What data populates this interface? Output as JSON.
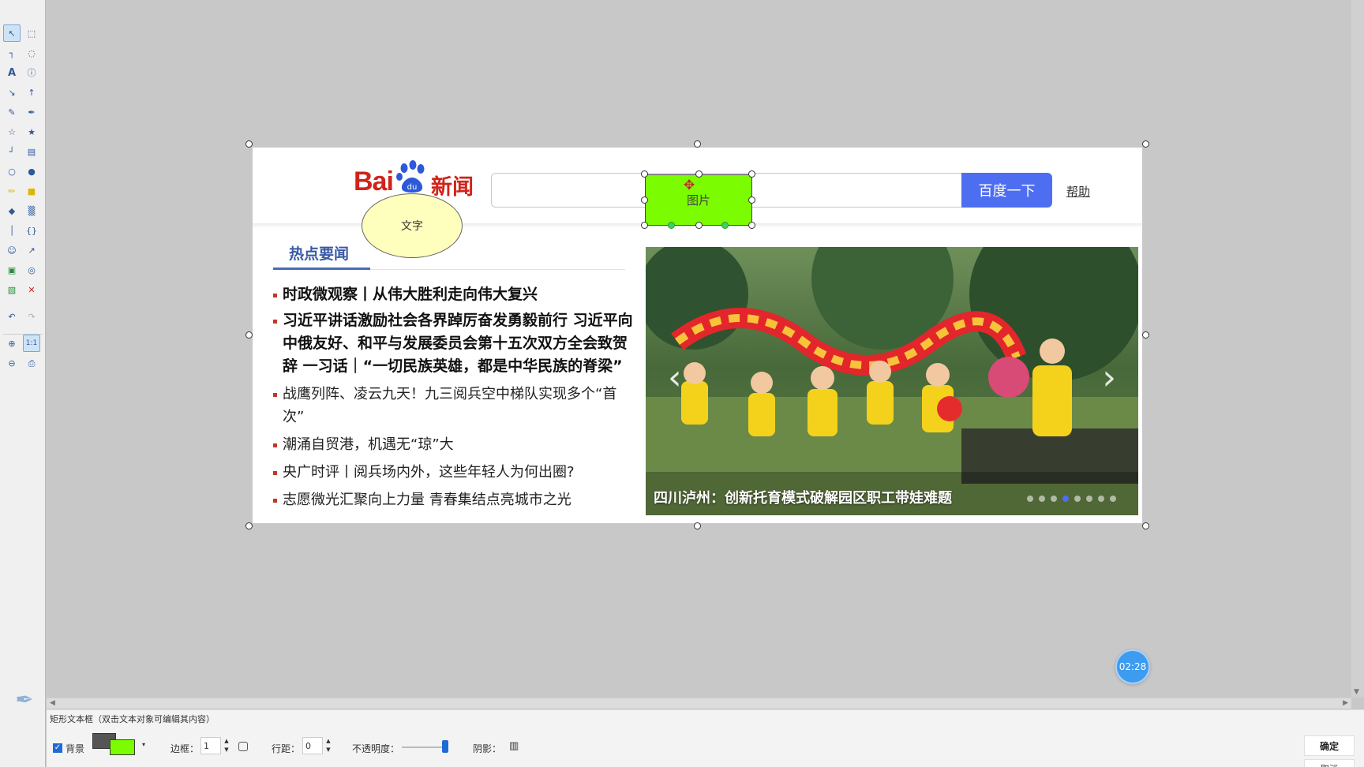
{
  "page": {
    "logo_left": "Bai",
    "logo_right": "新闻",
    "search_button": "百度一下",
    "help_link": "帮助",
    "tab_label": "热点要闻",
    "news": [
      "时政微观察丨从伟大胜利走向伟大复兴",
      "习近平讲话激励社会各界踔厉奋发勇毅前行  习近平向中俄友好、和平与发展委员会第十五次双方全会致贺辞  一习话｜“一切民族英雄，都是中华民族的脊梁”",
      "战鹰列阵、凌云九天！九三阅兵空中梯队实现多个“首次”",
      "潮涌自贸港，机遇无“琼”大",
      "央广时评丨阅兵场内外，这些年轻人为何出圈?",
      "志愿微光汇聚向上力量 青春集结点亮城市之光"
    ],
    "carousel": {
      "prev": "‹",
      "next": "›",
      "caption": "四川泸州：创新托育模式破解园区职工带娃难题",
      "slide_count": 8,
      "active_slide": 4
    }
  },
  "annotations": {
    "ellipse_text": "文字",
    "ellipse_fill": "#ffffbd",
    "rect_text": "图片",
    "rect_fill": "#7cfc00"
  },
  "status": {
    "text": "矩形文本框（双击文本对象可编辑其内容）"
  },
  "properties": {
    "background_label": "背景",
    "background_checked": true,
    "border_color": "#555555",
    "fill_color": "#7cfc00",
    "border_label": "边框：",
    "border_value": "1",
    "line_spacing_label": "行距：",
    "line_spacing_value": "0",
    "opacity_label": "不透明度：",
    "opacity_level": 0.9,
    "shadow_label": "阴影："
  },
  "buttons": {
    "ok": "确定",
    "cancel": "取消"
  },
  "timer": "02:28",
  "accent_color": "#4e6ef2"
}
